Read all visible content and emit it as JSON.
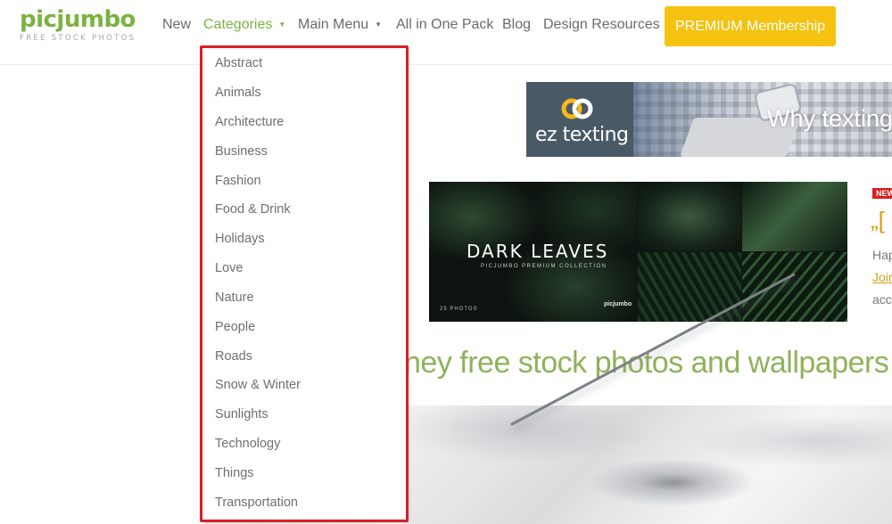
{
  "logo": {
    "name": "picjumbo",
    "tagline": "FREE STOCK PHOTOS"
  },
  "nav": {
    "items": [
      {
        "label": "New"
      },
      {
        "label": "Categories",
        "active": true,
        "has_dropdown": true
      },
      {
        "label": "Main Menu",
        "has_dropdown": true
      },
      {
        "label": "All in One Pack"
      },
      {
        "label": "Blog"
      },
      {
        "label": "Design Resources"
      }
    ],
    "premium_button": "PREMIUM Membership",
    "colors": {
      "brand_green": "#7bb240",
      "premium_yellow": "#f4c20f",
      "highlight_red": "#d81f26"
    }
  },
  "categories_menu": {
    "items": [
      "Abstract",
      "Animals",
      "Architecture",
      "Business",
      "Fashion",
      "Food & Drink",
      "Holidays",
      "Love",
      "Nature",
      "People",
      "Roads",
      "Snow & Winter",
      "Sunlights",
      "Technology",
      "Things",
      "Transportation"
    ]
  },
  "ad": {
    "brand": "ez texting",
    "headline": "Why texting"
  },
  "promo": {
    "title": "DARK LEAVES",
    "subtitle": "PICJUMBO PREMIUM COLLECTION",
    "count": "25 PHOTOS",
    "mark": "picjumbo"
  },
  "side_card": {
    "badge": "NEW",
    "quote": "„[",
    "lines": [
      "Hap",
      "Join",
      "acc"
    ]
  },
  "main": {
    "heading": "ney free stock photos and wallpapers"
  }
}
